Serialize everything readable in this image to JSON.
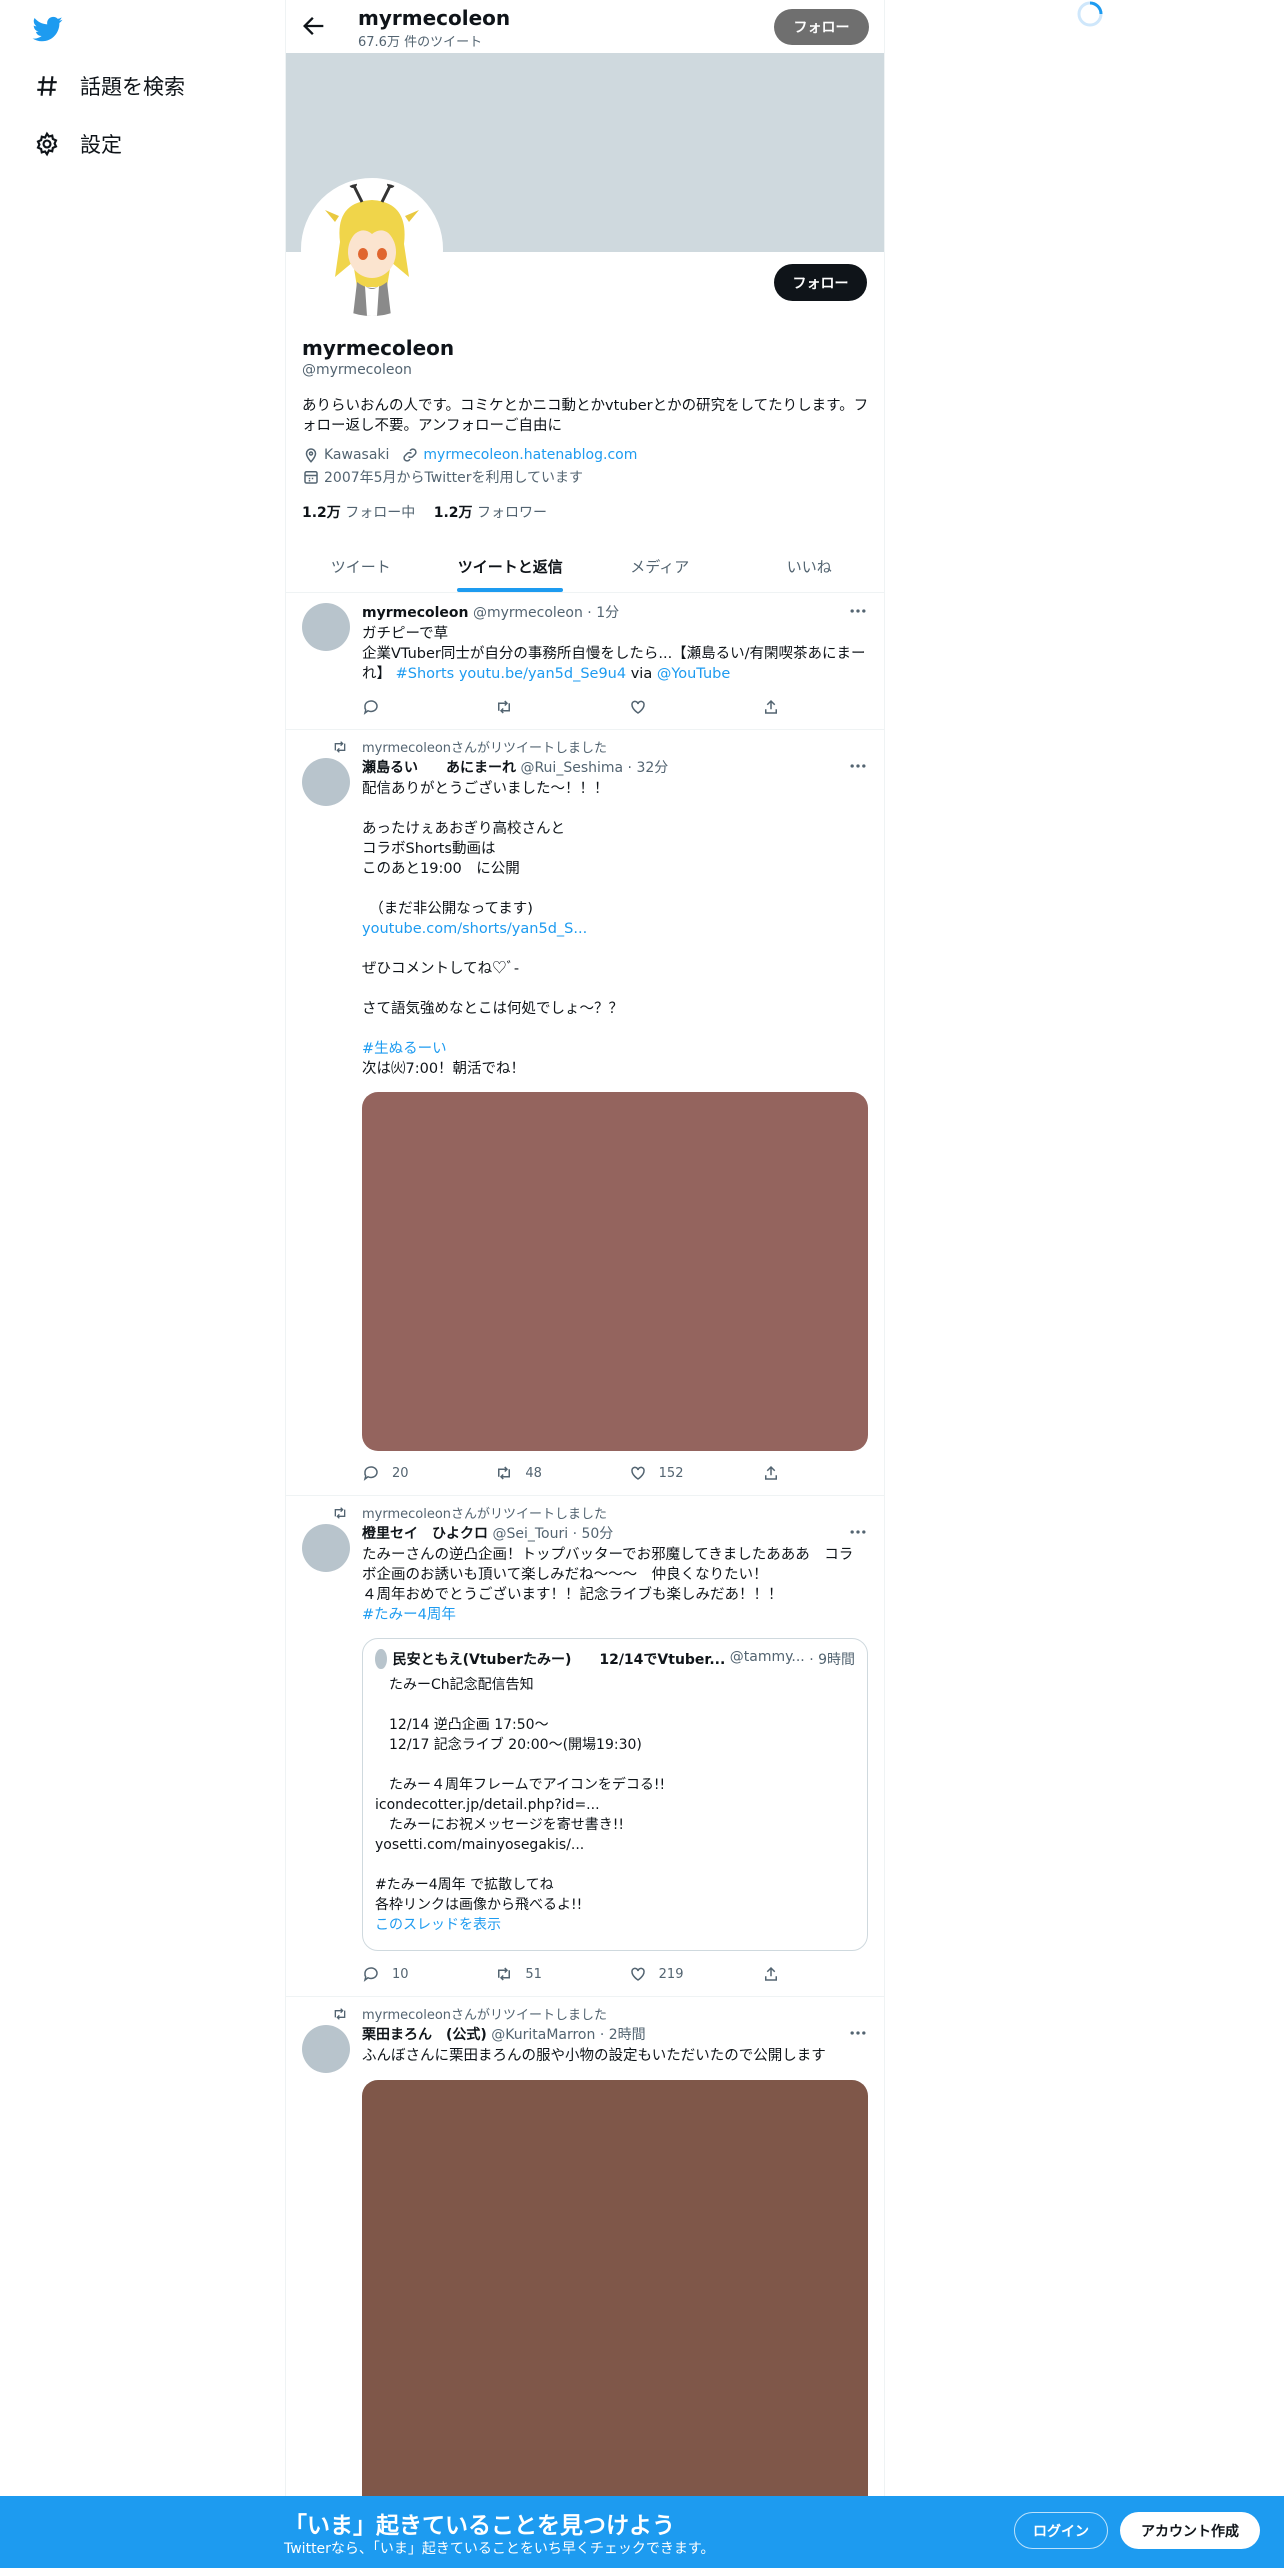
{
  "nav": {
    "logo": "twitter-bird-icon",
    "items": [
      {
        "label": "話題を検索",
        "icon": "hashtag-icon"
      },
      {
        "label": "設定",
        "icon": "gear-icon"
      }
    ]
  },
  "header": {
    "name": "myrmecoleon",
    "tweet_count": "67.6万 件のツイート",
    "follow_label": "フォロー"
  },
  "profile": {
    "name": "myrmecoleon",
    "handle": "@myrmecoleon",
    "follow_label": "フォロー",
    "bio": "ありらいおんの人です。コミケとかニコ動とかvtuberとかの研究をしてたりします。フォロー返し不要。アンフォローご自由に",
    "location": "Kawasaki",
    "website": "myrmecoleon.hatenablog.com",
    "joined": "2007年5月からTwitterを利用しています",
    "following_count": "1.2万",
    "following_label": "フォロー中",
    "followers_count": "1.2万",
    "followers_label": "フォロワー"
  },
  "tabs": [
    {
      "label": "ツイート",
      "active": false
    },
    {
      "label": "ツイートと返信",
      "active": true
    },
    {
      "label": "メディア",
      "active": false
    },
    {
      "label": "いいね",
      "active": false
    }
  ],
  "tweets": [
    {
      "name": "myrmecoleon",
      "handle": "@myrmecoleon",
      "time": "· 1分",
      "text_line1": "ガチピーで草",
      "text_line2": "企業VTuber同士が自分の事務所自慢をしたら...【瀬島るい/有閑喫茶あにまーれ】",
      "hashtag": "#Shorts",
      "link": "youtu.be/yan5d_Se9u4",
      "via": "via",
      "mention": "@YouTube",
      "reply": "",
      "retweet": "",
      "like": ""
    },
    {
      "retweeted_by": "myrmecoleonさんがリツイートしました",
      "name": "瀬島るい　　あにまーれ",
      "handle": "@Rui_Seshima",
      "time": "· 32分",
      "text_a": "配信ありがとうございました〜！！！\n\nあったけぇあおぎり高校さんと\nコラボShorts動画は\nこのあと19:00　に公開\n\n　（まだ非公開なってます)",
      "link": "youtube.com/shorts/yan5d_S...",
      "text_b": "ぜひコメントしてね♡ﾞ-\n\nさて語気強めなとこは何処でしょ〜？？",
      "hashtag": "#生ぬるーい",
      "text_c": "次は㈫7:00！朝活でね！",
      "media_color": "#94645e",
      "reply": "20",
      "retweet": "48",
      "like": "152"
    },
    {
      "retweeted_by": "myrmecoleonさんがリツイートしました",
      "name": "橙里セイ　ひよクロ",
      "handle": "@Sei_Touri",
      "time": "· 50分",
      "text": "たみーさんの逆凸企画！トップバッターでお邪魔してきましたあああ　コラボ企画のお誘いも頂いて楽しみだね～～～　仲良くなりたい！\n４周年おめでとうございます！！記念ライブも楽しみだあ！！！",
      "hashtag": "#たみー4周年",
      "quote": {
        "name": "民安ともえ(Vtuberたみー)　　12/14でVtuber...",
        "handle": "@tammy...",
        "time": "· 9時間",
        "text_a": "　たみーCh記念配信告知\n\n　12/14 逆凸企画 17:50～\n　12/17 記念ライブ 20:00～(開場19:30)\n\n　たみー４周年フレームでアイコンをデコる!!",
        "link1": "icondecotter.jp/detail.php?id=...",
        "text_b": "　たみーにお祝メッセージを寄せ書き!!",
        "link2": "yosetti.com/mainyosegakis/...",
        "text_c": "\n#たみー4周年 で拡散してね\n各枠リンクは画像から飛べるよ!!",
        "show_thread": "このスレッドを表示"
      },
      "reply": "10",
      "retweet": "51",
      "like": "219"
    },
    {
      "retweeted_by": "myrmecoleonさんがリツイートしました",
      "name": "栗田まろん　(公式)",
      "handle": "@KuritaMarron",
      "time": "· 2時間",
      "text": "ふんぼさんに栗田まろんの服や小物の設定もいただいたので公開します",
      "media_color": "#7f5749"
    }
  ],
  "bottom_bar": {
    "title": "「いま」起きていることを見つけよう",
    "subtitle": "Twitterなら、「いま」起きていることをいち早くチェックできます。",
    "login_label": "ログイン",
    "signup_label": "アカウント作成"
  },
  "colors": {
    "accent": "#1d9bf0",
    "banner": "#cfd9de",
    "text_primary": "#0f1419",
    "text_secondary": "#536471"
  }
}
